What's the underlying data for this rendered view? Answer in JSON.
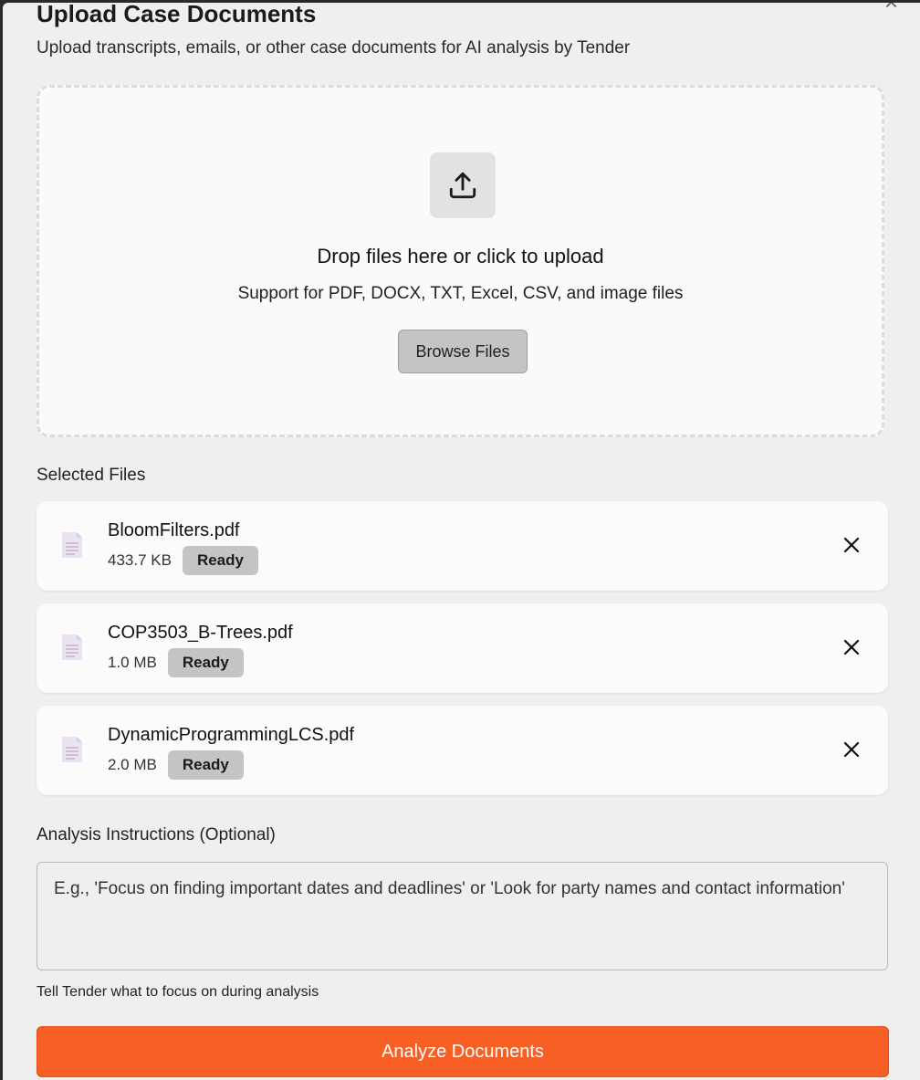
{
  "modal": {
    "title": "Upload Case Documents",
    "subtitle": "Upload transcripts, emails, or other case documents for AI analysis by Tender",
    "close_icon": "close-icon"
  },
  "dropzone": {
    "icon": "upload-icon",
    "title": "Drop files here or click to upload",
    "subtitle": "Support for PDF, DOCX, TXT, Excel, CSV, and image files",
    "browse_label": "Browse Files"
  },
  "selected_files": {
    "heading": "Selected Files",
    "items": [
      {
        "name": "BloomFilters.pdf",
        "size": "433.7 KB",
        "status": "Ready"
      },
      {
        "name": "COP3503_B-Trees.pdf",
        "size": "1.0 MB",
        "status": "Ready"
      },
      {
        "name": "DynamicProgrammingLCS.pdf",
        "size": "2.0 MB",
        "status": "Ready"
      }
    ]
  },
  "instructions": {
    "label": "Analysis Instructions (Optional)",
    "placeholder": "E.g., 'Focus on finding important dates and deadlines' or 'Look for party names and contact information'",
    "value": "",
    "hint": "Tell Tender what to focus on during analysis"
  },
  "actions": {
    "analyze_label": "Analyze Documents"
  },
  "colors": {
    "accent": "#f75f25",
    "badge_bg": "#c4c4c4",
    "background": "#efefef"
  }
}
